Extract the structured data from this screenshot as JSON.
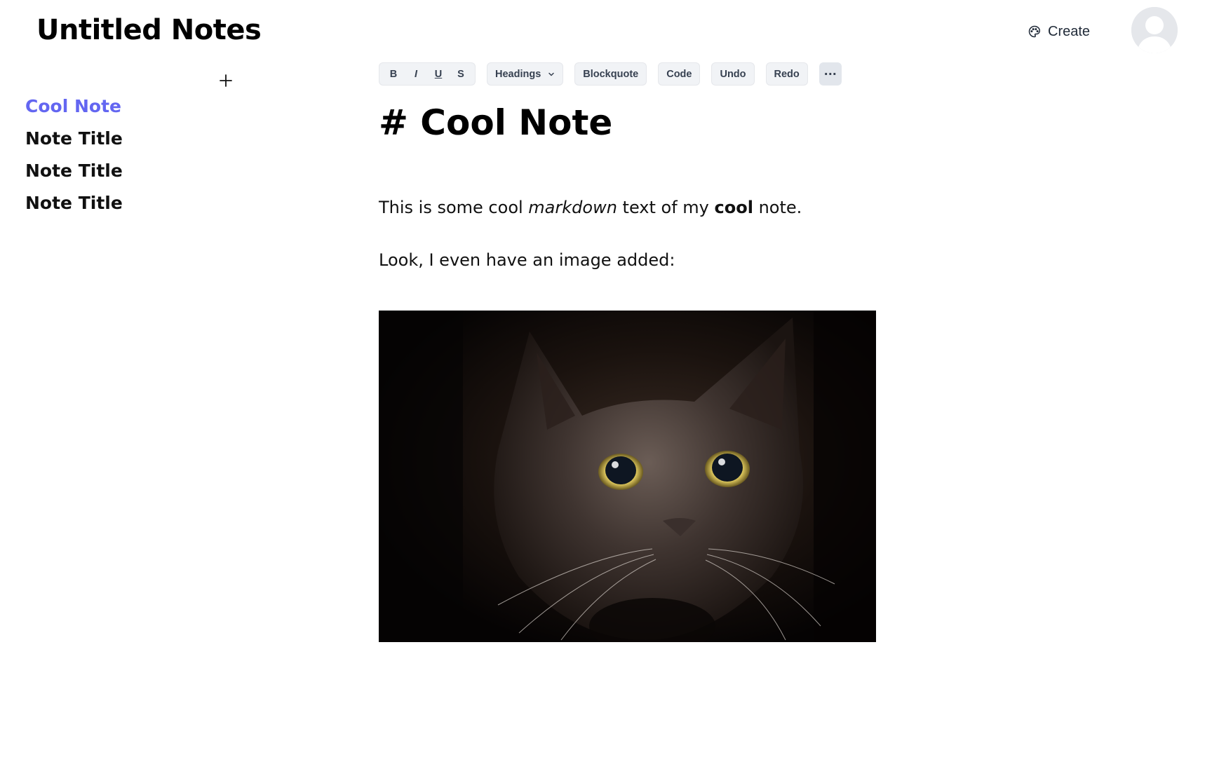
{
  "header": {
    "app_title": "Untitled Notes",
    "create_label": "Create",
    "create_icon": "palette-icon",
    "avatar_icon": "user-avatar-icon"
  },
  "sidebar": {
    "add_icon": "plus-icon",
    "notes": [
      {
        "title": "Cool Note",
        "active": true
      },
      {
        "title": "Note Title",
        "active": false
      },
      {
        "title": "Note Title",
        "active": false
      },
      {
        "title": "Note Title",
        "active": false
      }
    ]
  },
  "toolbar": {
    "bold": "B",
    "italic": "I",
    "underline": "U",
    "strike": "S",
    "headings": "Headings",
    "blockquote": "Blockquote",
    "code": "Code",
    "undo": "Undo",
    "redo": "Redo",
    "more": "···"
  },
  "editor": {
    "heading": "# Cool Note",
    "p1_before": "This is some cool ",
    "p1_em": "markdown",
    "p1_mid": " text of my ",
    "p1_strong": "cool",
    "p1_after": " note.",
    "p2": "Look, I even have an image added:",
    "image_subject": "black cat with yellow eyes"
  },
  "colors": {
    "accent": "#6366f1",
    "text": "#000000",
    "toolbar_bg": "#f1f3f6",
    "toolbar_text": "#374151"
  }
}
